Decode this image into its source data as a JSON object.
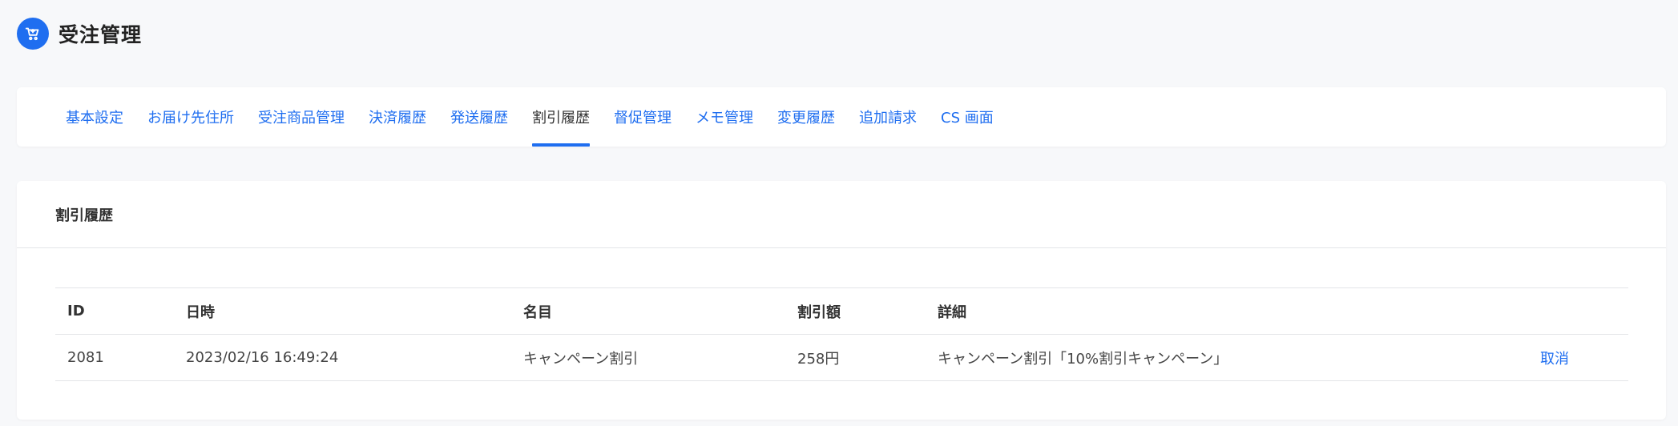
{
  "header": {
    "title": "受注管理",
    "icon": "cart-icon"
  },
  "colors": {
    "accent": "#1f6ef0",
    "background": "#f7f8fa",
    "card": "#ffffff",
    "border": "#e3e5e8"
  },
  "tabs": [
    {
      "label": "基本設定",
      "active": false
    },
    {
      "label": "お届け先住所",
      "active": false
    },
    {
      "label": "受注商品管理",
      "active": false
    },
    {
      "label": "決済履歴",
      "active": false
    },
    {
      "label": "発送履歴",
      "active": false
    },
    {
      "label": "割引履歴",
      "active": true
    },
    {
      "label": "督促管理",
      "active": false
    },
    {
      "label": "メモ管理",
      "active": false
    },
    {
      "label": "変更履歴",
      "active": false
    },
    {
      "label": "追加請求",
      "active": false
    },
    {
      "label": "CS 画面",
      "active": false
    }
  ],
  "section": {
    "title": "割引履歴"
  },
  "table": {
    "columns": [
      "ID",
      "日時",
      "名目",
      "割引額",
      "詳細"
    ],
    "rows": [
      {
        "id": "2081",
        "datetime": "2023/02/16 16:49:24",
        "name": "キャンペーン割引",
        "amount": "258円",
        "detail": "キャンペーン割引「10%割引キャンペーン」",
        "action": "取消"
      }
    ]
  }
}
